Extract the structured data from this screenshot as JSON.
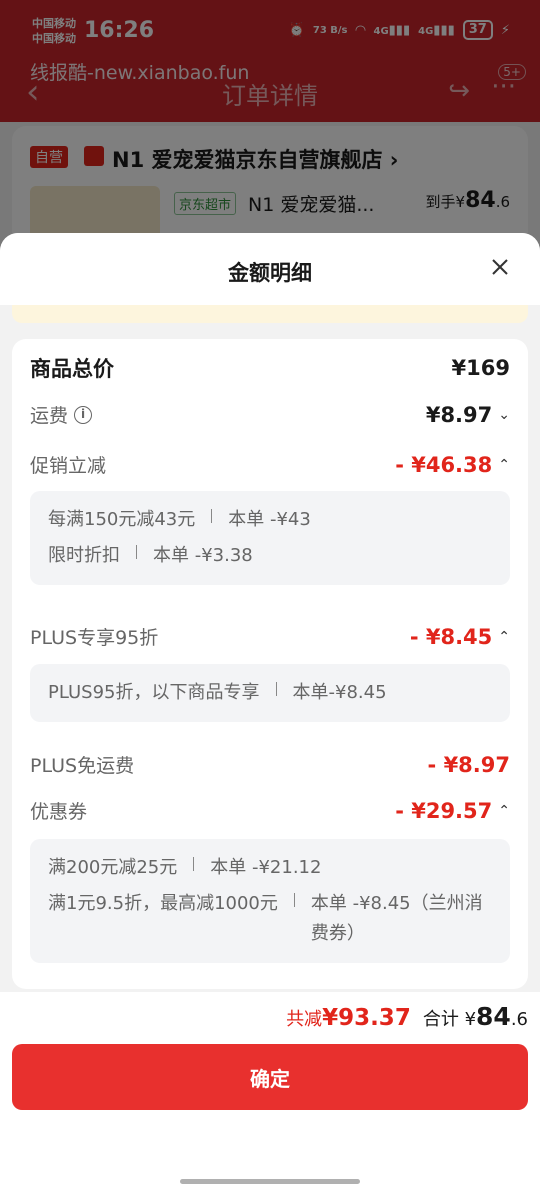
{
  "status_bar": {
    "carrier_1": "中国移动",
    "carrier_2": "中国移动",
    "time": "16:26",
    "net_speed": "73 B/s",
    "signal_1": "4G",
    "signal_2": "4G",
    "battery": "37"
  },
  "watermark": "线报酷-new.xianbao.fun",
  "nav": {
    "title": "订单详情",
    "badge": "5+"
  },
  "order_card": {
    "store_tag": "自营",
    "store_name": "N1 爱宠爱猫京东自营旗舰店 ›",
    "product_tag": "京东超市",
    "product_name": "N1 爱宠爱猫...",
    "price_prefix": "到手¥",
    "price_main": "84",
    "price_decimal": ".6"
  },
  "sheet": {
    "title": "金额明细",
    "rows": {
      "goods_total": {
        "label": "商品总价",
        "value": "¥169"
      },
      "shipping": {
        "label": "运费",
        "value": "¥8.97"
      },
      "promo": {
        "label": "促销立减",
        "value": "- ¥46.38"
      },
      "plus": {
        "label": "PLUS专享95折",
        "value": "- ¥8.45"
      },
      "plus_ship": {
        "label": "PLUS免运费",
        "value": "- ¥8.97"
      },
      "coupon": {
        "label": "优惠券",
        "value": "- ¥29.57"
      }
    },
    "promo_details": [
      {
        "desc": "每满150元减43元",
        "amount": "本单 -¥43"
      },
      {
        "desc": "限时折扣",
        "amount": "本单 -¥3.38"
      }
    ],
    "plus_details": [
      {
        "desc": "PLUS95折，以下商品专享",
        "amount": "本单-¥8.45"
      }
    ],
    "coupon_details": [
      {
        "desc": "满200元减25元",
        "amount": "本单 -¥21.12"
      },
      {
        "desc": "满1元9.5折，最高减1000元",
        "amount": "本单 -¥8.45（兰州消费券）"
      }
    ]
  },
  "footer": {
    "saved_label": "共减",
    "saved_value": "¥93.37",
    "total_label": "合计",
    "total_currency": "¥",
    "total_main": "84",
    "total_decimal": ".6",
    "confirm_label": "确定"
  },
  "colors": {
    "accent_red": "#e1251b",
    "header_red": "#c8252b",
    "button_red": "#e8302e"
  }
}
